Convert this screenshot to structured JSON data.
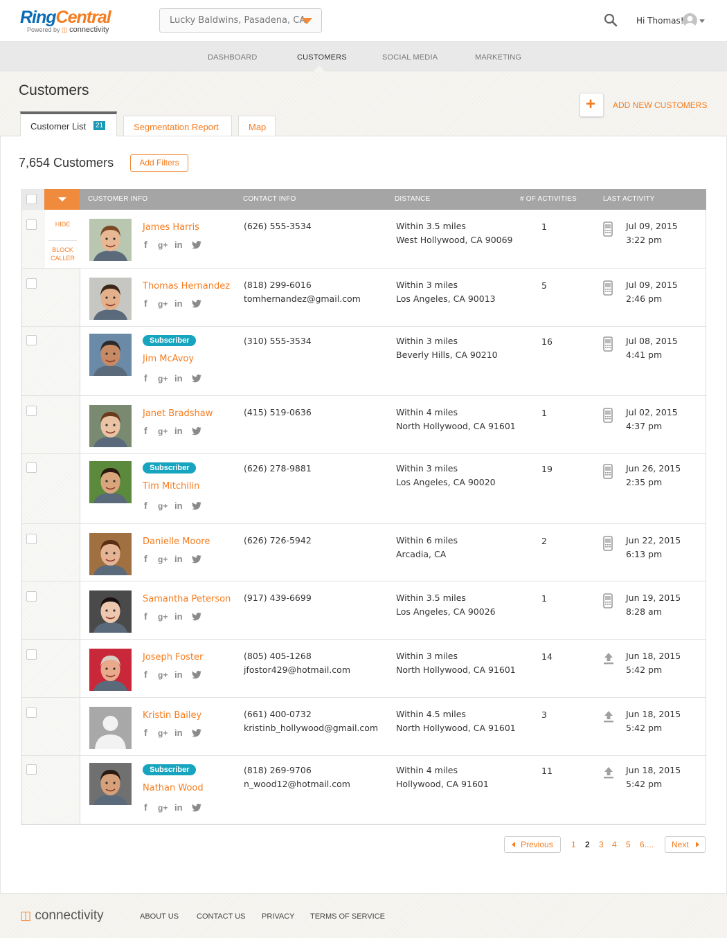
{
  "brand": {
    "ring": "Ring",
    "central": "Central",
    "powered_by": "Powered by",
    "partner": "connectivity"
  },
  "location": {
    "value": "Lucky Baldwins, Pasadena, CA"
  },
  "user": {
    "greeting": "Hi Thomas!"
  },
  "nav": {
    "items": [
      "DASHBOARD",
      "CUSTOMERS",
      "SOCIAL MEDIA",
      "MARKETING"
    ],
    "active": "CUSTOMERS"
  },
  "page": {
    "title": "Customers",
    "add_label": "ADD NEW CUSTOMERS",
    "add_symbol": "+"
  },
  "tabs": [
    {
      "label": "Customer List",
      "badge": "21"
    },
    {
      "label": "Segmentation Report"
    },
    {
      "label": "Map"
    }
  ],
  "summary": {
    "count_label": "7,654 Customers",
    "filter_label": "Add Filters"
  },
  "table": {
    "headers": [
      "CUSTOMER INFO",
      "CONTACT INFO",
      "DISTANCE",
      "# OF ACTIVITIES",
      "LAST ACTIVITY"
    ],
    "row_actions": {
      "hide": "HIDE",
      "block_line1": "BLOCK",
      "block_line2": "CALLER"
    },
    "subscriber_label": "Subscriber",
    "social_icons": [
      "facebook-icon",
      "google-plus-icon",
      "linkedin-icon",
      "twitter-icon"
    ],
    "rows": [
      {
        "name": "James Harris",
        "subscriber": false,
        "phone": "(626) 555-3534",
        "email": "",
        "distance": "Within 3.5 miles",
        "city": "West Hollywood, CA 90069",
        "activities": "1",
        "activity_icon": "mobile-phone-icon",
        "date": "Jul 09, 2015",
        "time": "3:22 pm"
      },
      {
        "name": "Thomas Hernandez",
        "subscriber": false,
        "phone": "(818) 299-6016",
        "email": "tomhernandez@gmail.com",
        "distance": "Within 3 miles",
        "city": "Los Angeles, CA 90013",
        "activities": "5",
        "activity_icon": "mobile-phone-icon",
        "date": "Jul 09, 2015",
        "time": "2:46 pm"
      },
      {
        "name": "Jim McAvoy",
        "subscriber": true,
        "phone": "(310) 555-3534",
        "email": "",
        "distance": "Within 3 miles",
        "city": "Beverly Hills, CA 90210",
        "activities": "16",
        "activity_icon": "mobile-phone-icon",
        "date": "Jul 08, 2015",
        "time": "4:41 pm"
      },
      {
        "name": "Janet Bradshaw",
        "subscriber": false,
        "phone": "(415) 519-0636",
        "email": "",
        "distance": "Within 4 miles",
        "city": "North Hollywood, CA 91601",
        "activities": "1",
        "activity_icon": "mobile-phone-icon",
        "date": "Jul 02, 2015",
        "time": "4:37 pm"
      },
      {
        "name": "Tim Mitchilin",
        "subscriber": true,
        "phone": "(626) 278-9881",
        "email": "",
        "distance": "Within 3 miles",
        "city": "Los Angeles, CA 90020",
        "activities": "19",
        "activity_icon": "mobile-phone-icon",
        "date": "Jun 26, 2015",
        "time": "2:35 pm"
      },
      {
        "name": "Danielle Moore",
        "subscriber": false,
        "phone": "(626) 726-5942",
        "email": "",
        "distance": "Within 6 miles",
        "city": "Arcadia, CA",
        "activities": "2",
        "activity_icon": "mobile-phone-icon",
        "date": "Jun 22, 2015",
        "time": "6:13 pm"
      },
      {
        "name": "Samantha Peterson",
        "subscriber": false,
        "phone": "(917) 439-6699",
        "email": "",
        "distance": "Within 3.5 miles",
        "city": "Los Angeles, CA 90026",
        "activities": "1",
        "activity_icon": "mobile-phone-icon",
        "date": "Jun 19, 2015",
        "time": "8:28 am"
      },
      {
        "name": "Joseph Foster",
        "subscriber": false,
        "phone": "(805) 405-1268",
        "email": "jfostor429@hotmail.com",
        "distance": "Within 3 miles",
        "city": "North Hollywood, CA 91601",
        "activities": "14",
        "activity_icon": "upload-icon",
        "date": "Jun 18, 2015",
        "time": "5:42 pm"
      },
      {
        "name": "Kristin Bailey",
        "subscriber": false,
        "phone": "(661) 400-0732",
        "email": "kristinb_hollywood@gmail.com",
        "distance": "Within 4.5 miles",
        "city": "North Hollywood, CA 91601",
        "activities": "3",
        "activity_icon": "upload-icon",
        "date": "Jun 18, 2015",
        "time": "5:42 pm"
      },
      {
        "name": "Nathan Wood",
        "subscriber": true,
        "phone": "(818) 269-9706",
        "email": "n_wood12@hotmail.com",
        "distance": "Within 4 miles",
        "city": "Hollywood, CA 91601",
        "activities": "11",
        "activity_icon": "upload-icon",
        "date": "Jun 18, 2015",
        "time": "5:42 pm"
      }
    ]
  },
  "pagination": {
    "previous": "Previous",
    "next": "Next",
    "pages": [
      "1",
      "2",
      "3",
      "4",
      "5",
      "6...."
    ],
    "current": "2"
  },
  "footer": {
    "logo": "connectivity",
    "links": [
      "ABOUT US",
      "CONTACT US",
      "PRIVACY",
      "TERMS OF SERVICE"
    ]
  },
  "colors": {
    "accent": "#f57c1f",
    "brand_blue": "#0a6bb4",
    "badge_teal": "#16a4be",
    "header_gray": "#a5a5a5"
  }
}
